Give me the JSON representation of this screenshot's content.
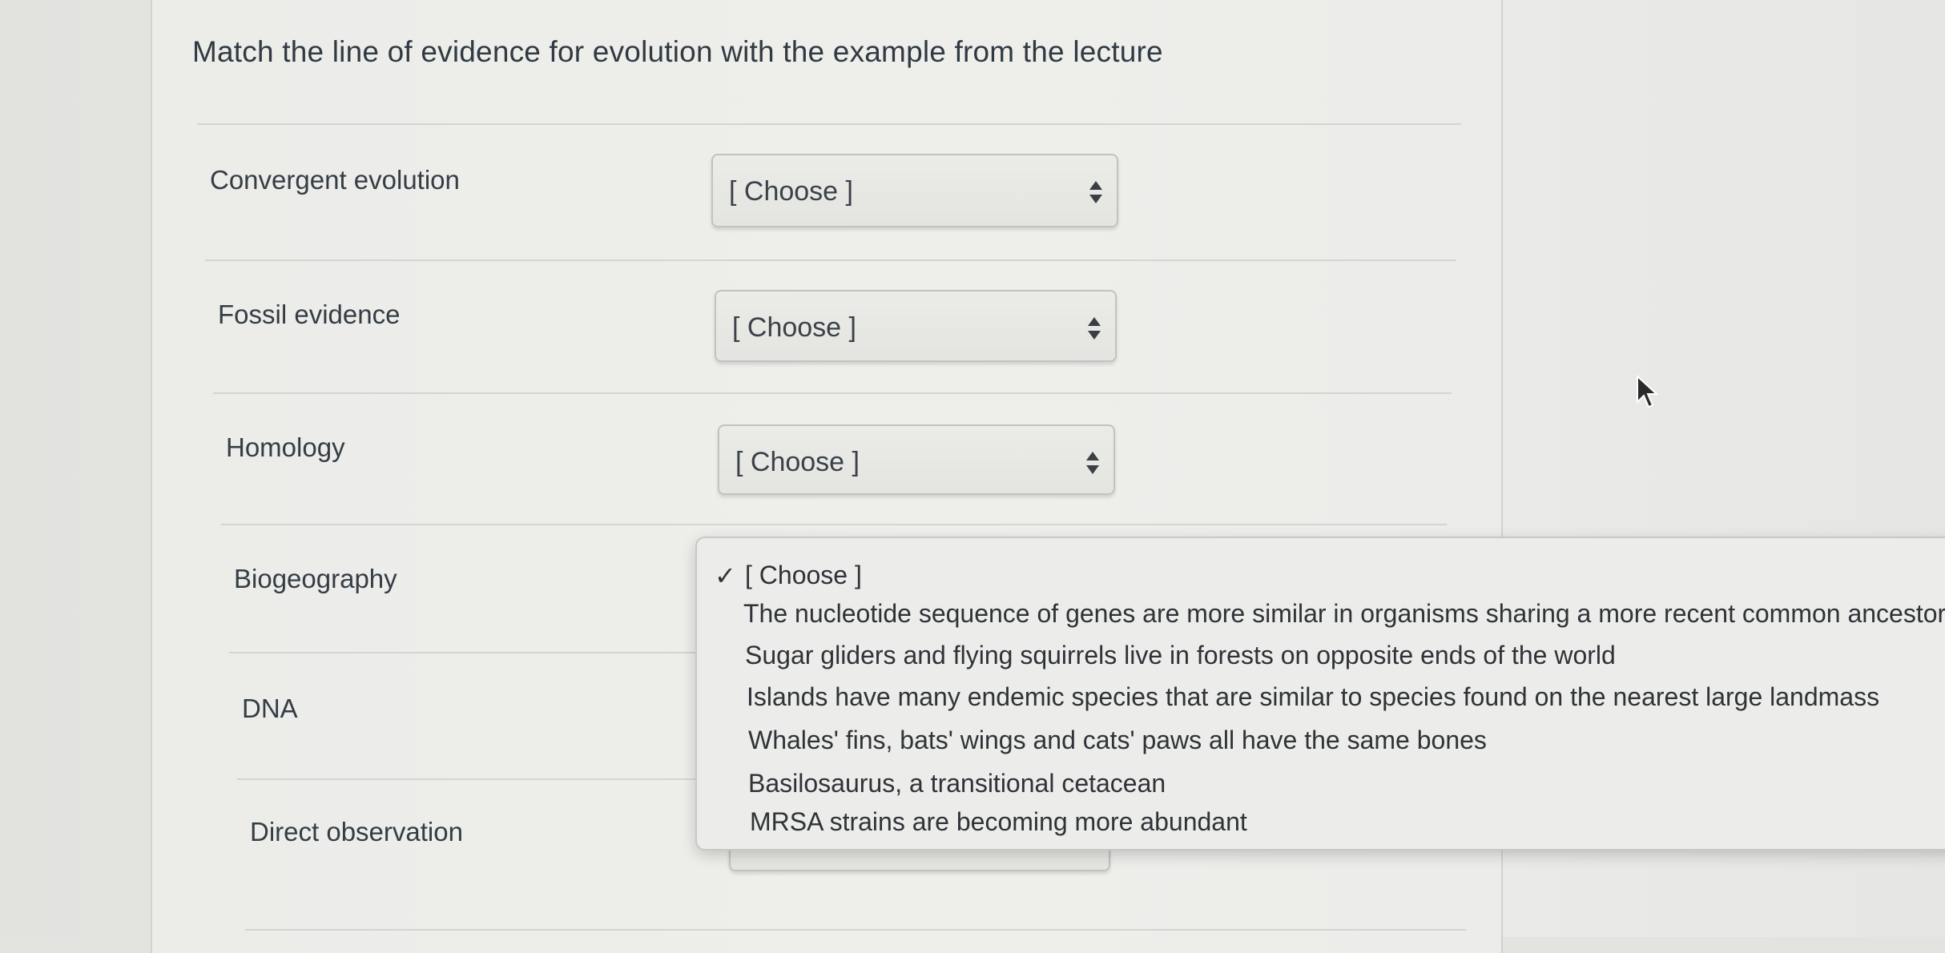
{
  "question": {
    "text": "Match the line of evidence for evolution with the example from the lecture"
  },
  "rows": [
    {
      "label": "Convergent evolution",
      "selected": "[ Choose ]"
    },
    {
      "label": "Fossil evidence",
      "selected": "[ Choose ]"
    },
    {
      "label": "Homology",
      "selected": "[ Choose ]"
    },
    {
      "label": "Biogeography",
      "selected": ""
    },
    {
      "label": "DNA",
      "selected": ""
    },
    {
      "label": "Direct observation",
      "selected": ""
    }
  ],
  "dropdown": {
    "checkmark": "✓",
    "options": [
      "[ Choose ]",
      "The nucleotide sequence of genes are more similar in organisms sharing a more recent common ancestor",
      "Sugar gliders and flying squirrels live in forests on opposite ends of the world",
      "Islands have many endemic species that are similar to species found on the nearest large landmass",
      "Whales' fins, bats' wings and cats' paws all have the same bones",
      "Basilosaurus, a transitional cetacean",
      "MRSA strains are becoming more abundant"
    ]
  },
  "icons": {
    "select_arrows": "updown-arrows-icon",
    "cursor": "mouse-pointer-icon"
  }
}
